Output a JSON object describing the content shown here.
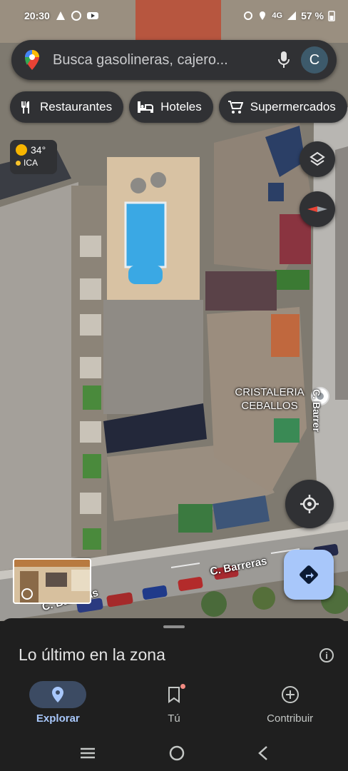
{
  "status_bar": {
    "time": "20:30",
    "network": "4G",
    "battery": "57 %"
  },
  "search": {
    "placeholder": "Busca gasolineras, cajero...",
    "avatar_letter": "C"
  },
  "chips": [
    {
      "label": "Restaurantes",
      "icon": "fork-knife-icon"
    },
    {
      "label": "Hoteles",
      "icon": "bed-icon"
    },
    {
      "label": "Supermercados",
      "icon": "cart-icon"
    }
  ],
  "weather": {
    "temperature": "34°",
    "air_quality": "ICA"
  },
  "map": {
    "poi_name": "CRISTALERIA\nCEBALLOS",
    "street_main": "C. Barreras",
    "street_lower": "C. Barreras",
    "street_right": "C. Barrer"
  },
  "sheet": {
    "title": "Lo último en la zona"
  },
  "nav": [
    {
      "label": "Explorar",
      "icon": "location-pin-icon",
      "active": true
    },
    {
      "label": "Tú",
      "icon": "bookmark-icon",
      "active": false
    },
    {
      "label": "Contribuir",
      "icon": "add-circle-icon",
      "active": false
    }
  ],
  "colors": {
    "accent": "#a8c7fa",
    "surface": "#303134",
    "sheet": "#1f1f1f"
  }
}
